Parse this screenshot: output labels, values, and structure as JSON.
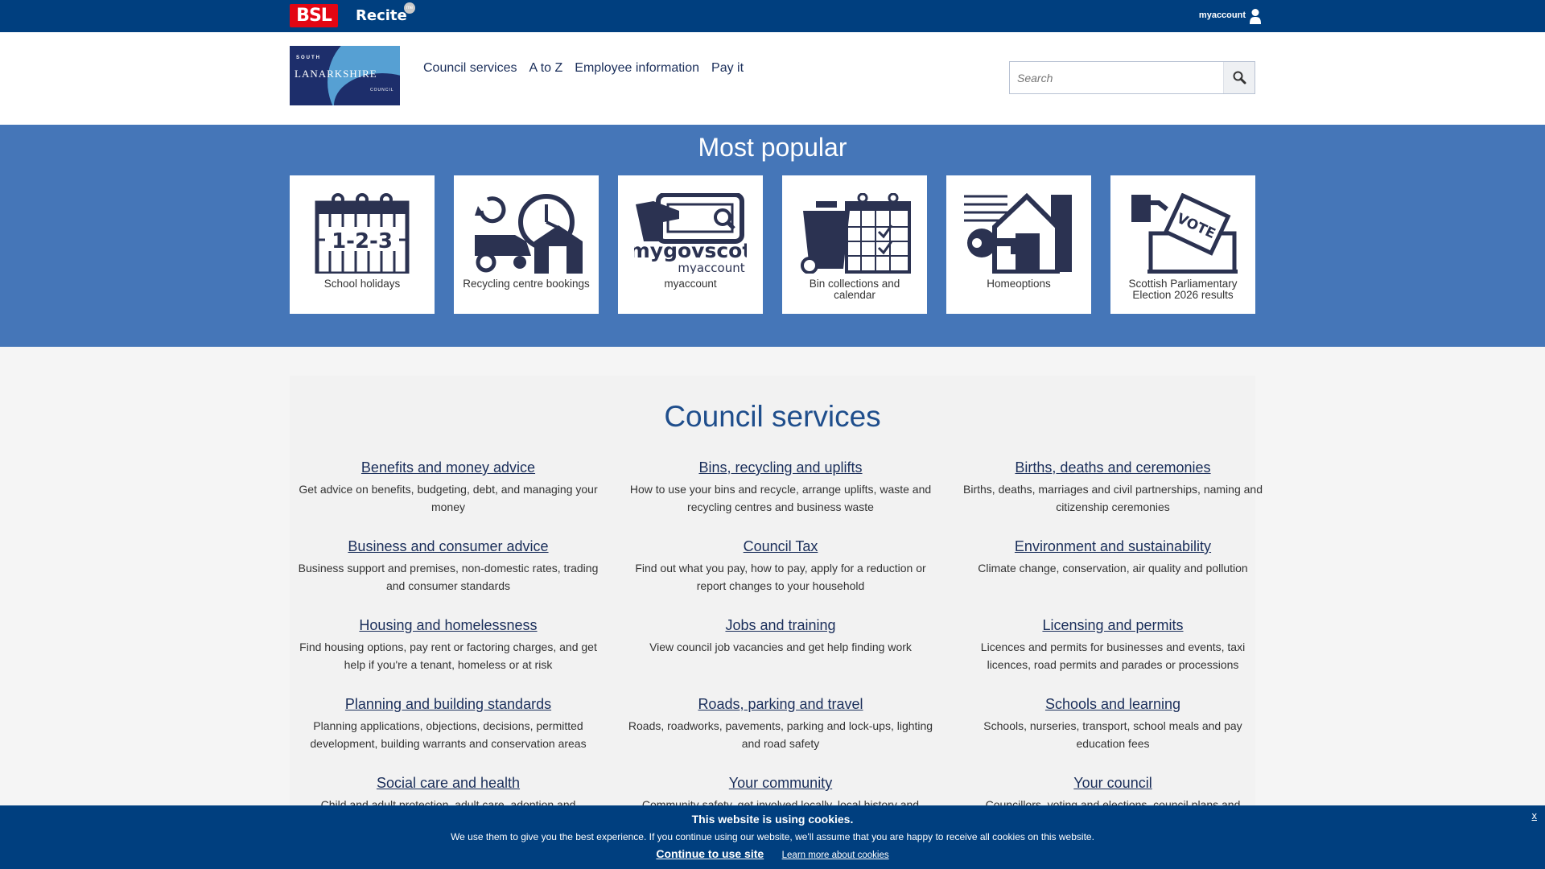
{
  "topbar": {
    "bsl_label": "BSL",
    "recite_label": "Recite",
    "recite_badge": "me",
    "account_label": "myaccount"
  },
  "header": {
    "logo": {
      "line1": "SOUTH",
      "line2": "LANARKSHIRE",
      "line3": "COUNCIL"
    },
    "nav": [
      "Council services",
      "A to Z",
      "Employee information",
      "Pay it"
    ],
    "search_placeholder": "Search"
  },
  "popular": {
    "title": "Most popular",
    "tiles": [
      {
        "label": "School holidays",
        "icon": "calendar-123-icon"
      },
      {
        "label": "Recycling centre bookings",
        "icon": "recycling-clock-icon"
      },
      {
        "label": "myaccount",
        "icon": "mygovscot-myaccount-icon",
        "logo_text1": "mygovscot",
        "logo_text2": "myaccount"
      },
      {
        "label": "Bin collections and calendar",
        "icon": "bin-calendar-icon"
      },
      {
        "label": "Homeoptions",
        "icon": "house-key-icon"
      },
      {
        "label": "Scottish Parliamentary Election 2026 results",
        "icon": "ballot-box-icon",
        "vote_text": "VOTE"
      }
    ]
  },
  "services": {
    "title": "Council services",
    "items": [
      {
        "title": "Benefits and money advice",
        "desc": "Get advice on benefits, budgeting, debt, and managing your money"
      },
      {
        "title": "Bins, recycling and uplifts",
        "desc": "How to use your bins and recycle, arrange uplifts, waste and recycling centres and business waste"
      },
      {
        "title": "Births, deaths and ceremonies",
        "desc": "Births, deaths, marriages and civil partnerships, naming and citizenship ceremonies"
      },
      {
        "title": "Business and consumer advice",
        "desc": "Business support and premises, non-domestic rates, trading and consumer standards"
      },
      {
        "title": "Council Tax",
        "desc": "Find out what you pay, how to pay, apply for a reduction or report changes to your household"
      },
      {
        "title": "Environment and sustainability",
        "desc": "Climate change, conservation, air quality and pollution"
      },
      {
        "title": "Housing and homelessness",
        "desc": "Find housing options, pay rent or factoring charges, and get help if you're a tenant, homeless or at risk"
      },
      {
        "title": "Jobs and training",
        "desc": "View council job vacancies and get help finding work"
      },
      {
        "title": "Licensing and permits",
        "desc": "Licences and permits for businesses and events, taxi licences, road permits and parades or processions"
      },
      {
        "title": "Planning and building standards",
        "desc": "Planning applications, objections, decisions, permitted development, building warrants and conservation areas"
      },
      {
        "title": "Roads, parking and travel",
        "desc": "Roads, roadworks, pavements, parking and lock-ups, lighting and road safety"
      },
      {
        "title": "Schools and learning",
        "desc": "Schools, nurseries, transport, school meals and pay education fees"
      },
      {
        "title": "Social care and health",
        "desc": "Child and adult protection, adult care, adoption and"
      },
      {
        "title": "Your community",
        "desc": "Community safety, get involved locally, local history and"
      },
      {
        "title": "Your council",
        "desc": "Councillors, voting and elections, council plans and"
      }
    ]
  },
  "cookie": {
    "title": "This website is using cookies.",
    "message": "We use them to give you the best experience. If you continue using our website, we'll assume that you are happy to receive all cookies on this website.",
    "continue_label": "Continue to use site",
    "learn_label": "Learn more about cookies",
    "close_label": "x"
  },
  "colors": {
    "topbar": "#003f7f",
    "popular_bg": "#4576b8",
    "icon_navy": "#2b3251",
    "heading_blue": "#1f4e8c",
    "bsl_red": "#e30613"
  }
}
